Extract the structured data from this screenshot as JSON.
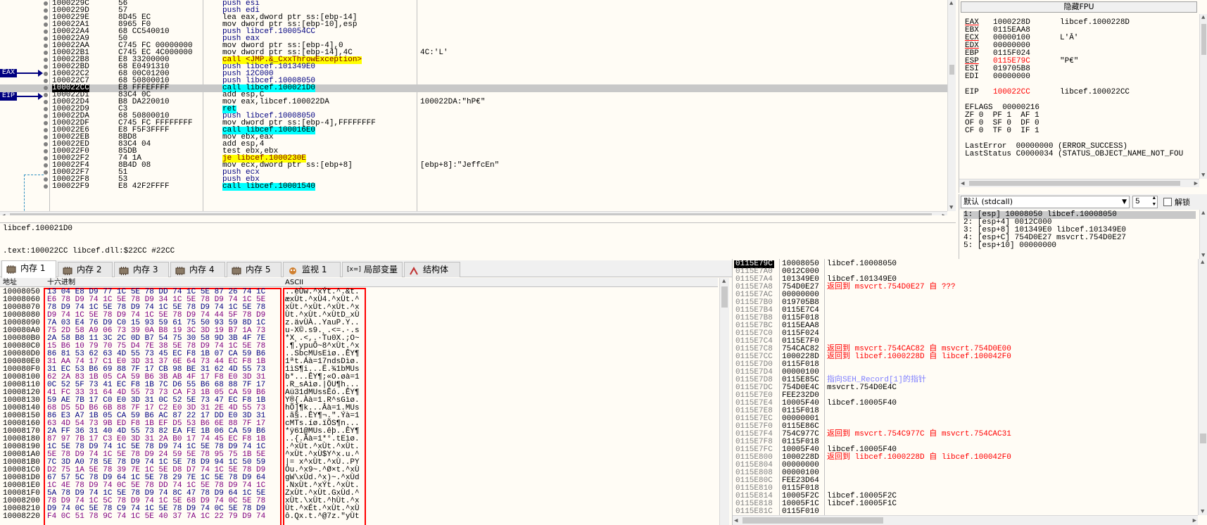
{
  "disasm": [
    {
      "addr": "1000229C",
      "bytes": "56",
      "ins": "push esi",
      "cmt": ""
    },
    {
      "addr": "1000229D",
      "bytes": "57",
      "ins": "push edi",
      "cmt": ""
    },
    {
      "addr": "1000229E",
      "bytes": "8D45 EC",
      "ins": "lea eax,dword ptr ss:[ebp-14]",
      "cmt": ""
    },
    {
      "addr": "100022A1",
      "bytes": "8965 F0",
      "ins": "mov dword ptr ss:[ebp-10],esp",
      "cmt": ""
    },
    {
      "addr": "100022A4",
      "bytes": "68 CC540010",
      "ins": "push libcef.100054CC",
      "cmt": ""
    },
    {
      "addr": "100022A9",
      "bytes": "50",
      "ins": "push eax",
      "cmt": ""
    },
    {
      "addr": "100022AA",
      "bytes": "C745 FC 00000000",
      "ins": "mov dword ptr ss:[ebp-4],0",
      "cmt": ""
    },
    {
      "addr": "100022B1",
      "bytes": "C745 EC 4C000000",
      "ins": "mov dword ptr ss:[ebp-14],4C",
      "cmt": "4C:'L'"
    },
    {
      "addr": "100022B8",
      "bytes": "E8 33200000",
      "ins": "call <JMP.&_CxxThrowException>",
      "cmt": ""
    },
    {
      "addr": "100022BD",
      "bytes": "68 E0491310",
      "ins": "push libcef.101349E0",
      "cmt": ""
    },
    {
      "addr": "100022C2",
      "bytes": "68 00C01200",
      "ins": "push 12C000",
      "cmt": ""
    },
    {
      "addr": "100022C7",
      "bytes": "68 50800010",
      "ins": "push libcef.10008050",
      "cmt": ""
    },
    {
      "addr": "100022CC",
      "bytes": "E8 FFFEFFFF",
      "ins": "call libcef.100021D0",
      "cmt": ""
    },
    {
      "addr": "100022D1",
      "bytes": "83C4 0C",
      "ins": "add esp,C",
      "cmt": ""
    },
    {
      "addr": "100022D4",
      "bytes": "B8 DA220010",
      "ins": "mov eax,libcef.100022DA",
      "cmt": "100022DA:\"hP€\""
    },
    {
      "addr": "100022D9",
      "bytes": "C3",
      "ins": "ret",
      "cmt": ""
    },
    {
      "addr": "100022DA",
      "bytes": "68 50800010",
      "ins": "push libcef.10008050",
      "cmt": ""
    },
    {
      "addr": "100022DF",
      "bytes": "C745 FC FFFFFFFF",
      "ins": "mov dword ptr ss:[ebp-4],FFFFFFFF",
      "cmt": ""
    },
    {
      "addr": "100022E6",
      "bytes": "E8 F5F3FFFF",
      "ins": "call libcef.100016E0",
      "cmt": ""
    },
    {
      "addr": "100022EB",
      "bytes": "8BD8",
      "ins": "mov ebx,eax",
      "cmt": ""
    },
    {
      "addr": "100022ED",
      "bytes": "83C4 04",
      "ins": "add esp,4",
      "cmt": ""
    },
    {
      "addr": "100022F0",
      "bytes": "85DB",
      "ins": "test ebx,ebx",
      "cmt": ""
    },
    {
      "addr": "100022F2",
      "bytes": "74 1A",
      "ins": "je libcef.1000230E",
      "cmt": ""
    },
    {
      "addr": "100022F4",
      "bytes": "8B4D 08",
      "ins": "mov ecx,dword ptr ss:[ebp+8]",
      "cmt": "[ebp+8]:\"JeffcEn\""
    },
    {
      "addr": "100022F7",
      "bytes": "51",
      "ins": "push ecx",
      "cmt": ""
    },
    {
      "addr": "100022F8",
      "bytes": "53",
      "ins": "push ebx",
      "cmt": ""
    },
    {
      "addr": "100022F9",
      "bytes": "E8 42F2FFFF",
      "ins": "call libcef.10001540",
      "cmt": ""
    }
  ],
  "disasm_tags": {
    "eax": "EAX",
    "eip": "EIP"
  },
  "info": {
    "line1": "libcef.100021D0",
    "line2": ".text:100022CC libcef.dll:$22CC #22CC"
  },
  "regs": {
    "fpu_button": "隐藏FPU",
    "rows": [
      {
        "n": "EAX",
        "v": "1000228D",
        "x": "libcef.1000228D"
      },
      {
        "n": "EBX",
        "v": "0115EAA8",
        "x": ""
      },
      {
        "n": "ECX",
        "v": "00000100",
        "x": "L'Ā'"
      },
      {
        "n": "EDX",
        "v": "00000000",
        "x": ""
      },
      {
        "n": "EBP",
        "v": "0115F024",
        "x": ""
      },
      {
        "n": "ESP",
        "v": "0115E79C",
        "x": "\"P€\""
      },
      {
        "n": "ESI",
        "v": "019705B8",
        "x": ""
      },
      {
        "n": "EDI",
        "v": "00000000",
        "x": ""
      },
      {
        "n": "",
        "v": "",
        "x": ""
      },
      {
        "n": "EIP",
        "v": "100022CC",
        "x": "libcef.100022CC"
      },
      {
        "n": "",
        "v": "",
        "x": ""
      },
      {
        "n": "EFLAGS",
        "v": "  00000216",
        "x": ""
      },
      {
        "n": "ZF 0  PF 1  AF 1",
        "v": "",
        "x": ""
      },
      {
        "n": "OF 0  SF 0  DF 0",
        "v": "",
        "x": ""
      },
      {
        "n": "CF 0  TF 0  IF 1",
        "v": "",
        "x": ""
      },
      {
        "n": "",
        "v": "",
        "x": ""
      },
      {
        "n": "LastError  00000000 (ERROR_SUCCESS)",
        "v": "",
        "x": ""
      },
      {
        "n": "LastStatus C0000034 (STATUS_OBJECT_NAME_NOT_FOU",
        "v": "",
        "x": ""
      }
    ]
  },
  "callconv": {
    "selected": "默认 (stdcall)",
    "count": "5",
    "unlock_label": "解锁"
  },
  "args": [
    "1: [esp] 10008050 libcef.10008050",
    "2: [esp+4] 0012C000",
    "3: [esp+8] 101349E0 libcef.101349E0",
    "4: [esp+C] 754D0E27 msvcrt.754D0E27",
    "5: [esp+10] 00000000"
  ],
  "tabs": [
    "内存 1",
    "内存 2",
    "内存 3",
    "内存 4",
    "内存 5",
    "监视 1",
    "局部变量",
    "结构体"
  ],
  "tab_icons": [
    "memory-icon",
    "memory-icon",
    "memory-icon",
    "memory-icon",
    "memory-icon",
    "watch-icon",
    "locals-icon",
    "struct-icon"
  ],
  "tab_local_prefix": "[x=]",
  "dump_headers": {
    "addr": "地址",
    "hex": "十六进制",
    "ascii": "ASCII"
  },
  "dump": [
    {
      "a": "10008050",
      "h": "13 04 E8 D9 77 1C 5E 78 DD 74 1C 5E 87 26 74 1C",
      "s": "..èÙw.^xÝt.^.&t."
    },
    {
      "a": "10008060",
      "h": "E6 78 D9 74 1C 5E 78 D9 34 1C 5E 78 D9 74 1C 5E",
      "s": "æxÙt.^xÙ4.^xÙt.^"
    },
    {
      "a": "10008070",
      "h": "78 D9 74 1C 5E 78 D9 74 1C 5E 78 D9 74 1C 5E 78",
      "s": "xÙt.^xÙt.^xÙt.^x"
    },
    {
      "a": "10008080",
      "h": "D9 74 1C 5E 78 D9 74 1C 5E 78 D9 74 44 5F 78 D9",
      "s": "Ùt.^xÙt.^xÙtD_xÙ"
    },
    {
      "a": "10008090",
      "h": "7A 03 E4 76 D9 C0 15 93 59 61 75 50 93 59 8D 1C",
      "s": "z.ävÙÀ..YauP.Y.."
    },
    {
      "a": "100080A0",
      "h": "75 2D 58 A9 06 73 39 0A B8 19 3C 3D 19 B7 1A 73",
      "s": "u-X©.s9.¸.<=.·.s"
    },
    {
      "a": "100080B0",
      "h": "2A 58 B8 11 3C 2C 0D B7 54 75 30 58 9D 3B 4F 7E",
      "s": "*X¸.<,.·Tu0X.;O~"
    },
    {
      "a": "100080C0",
      "h": "15 B6 10 79 70 75 D4 7E 38 5E 78 D9 74 1C 5E 78",
      "s": ".¶.ypuÔ~8^xÙt.^x"
    },
    {
      "a": "100080D0",
      "h": "86 81 53 62 63 4D 55 73 45 EC F8 1B 07 CA 59 B6",
      "s": "..SbcMUsEìø..ÊY¶"
    },
    {
      "a": "100080E0",
      "h": "31 AA 74 17 C1 E0 3D 31 37 6E 64 73 44 EC F8 1B",
      "s": "1ªt.Áà=17ndsDìø."
    },
    {
      "a": "100080F0",
      "h": "31 EC 53 B6 69 88 7F 17 CB 98 BE 31 62 4D 55 73",
      "s": "1ìS¶i...Ë.¾1bMUs"
    },
    {
      "a": "10008100",
      "h": "62 2A 83 1B 05 CA 59 B6 3B AB 4F 17 F8 E0 3D 31",
      "s": "b*...ÊY¶;«O.øà=1"
    },
    {
      "a": "10008110",
      "h": "0C 52 5F 73 41 EC F8 1B 7C D6 55 B6 68 88 7F 17",
      "s": ".R_sAìø.|ÖU¶h..."
    },
    {
      "a": "10008120",
      "h": "41 FC 33 31 64 4D 55 73 73 CA F3 1B 05 CA 59 B6",
      "s": "Aü31dMUssÊó..ÊY¶"
    },
    {
      "a": "10008130",
      "h": "59 AE 7B 17 C0 E0 3D 31 0C 52 5E 73 47 EC F8 1B",
      "s": "Y®{.Àà=1.R^sGìø."
    },
    {
      "a": "10008140",
      "h": "68 D5 5D B6 6B 88 7F 17 C2 E0 3D 31 2E 4D 55 73",
      "s": "hÕ]¶k...Âà=1.MUs"
    },
    {
      "a": "10008150",
      "h": "86 E3 A7 1B 05 CA 59 B6 AC 87 22 17 DD E0 3D 31",
      "s": ".ã§..ÊY¶¬.\".Ýà=1"
    },
    {
      "a": "10008160",
      "h": "63 4D 54 73 9B ED F8 1B EF D5 53 B6 6E 88 7F 17",
      "s": "cMTs.íø.ïÕS¶n..."
    },
    {
      "a": "10008170",
      "h": "2A FF 36 31 40 4D 55 73 82 EA FE 1B 06 CA 59 B6",
      "s": "*ÿ61@MUs.êþ..ÊY¶"
    },
    {
      "a": "10008180",
      "h": "87 97 7B 17 C3 E0 3D 31 2A B0 17 74 45 EC F8 1B",
      "s": "..{.Ãà=1*°.tEìø."
    },
    {
      "a": "10008190",
      "h": "1C 5E 78 D9 74 1C 5E 78 D9 74 1C 5E 78 D9 74 1C",
      "s": ".^xÙt.^xÙt.^xÙt."
    },
    {
      "a": "100081A0",
      "h": "5E 78 D9 74 1C 5E 78 D9 24 59 5E 78 95 75 1B 5E",
      "s": "^xÙt.^xÙ$Y^x.u.^"
    },
    {
      "a": "100081B0",
      "h": "7C 3D A0 78 5E 78 D9 74 1C 5E 78 D9 94 1C 50 59",
      "s": "|= x^xÙt.^xÙ..PY"
    },
    {
      "a": "100081C0",
      "h": "D2 75 1A 5E 78 39 7E 1C 5E D8 D7 74 1C 5E 78 D9",
      "s": "Òu.^x9~.^Ø×t.^xÙ"
    },
    {
      "a": "100081D0",
      "h": "67 57 5C 78 D9 64 1C 5E 78 29 7E 1C 5E 78 D9 64",
      "s": "gW\\xÙd.^x)~.^xÙd"
    },
    {
      "a": "100081E0",
      "h": "1C 4E 78 D9 74 0C 5E 78 DD 74 1C 5E 78 D9 74 1C",
      "s": ".NxÙt.^xÝt.^xÙt."
    },
    {
      "a": "100081F0",
      "h": "5A 78 D9 74 1C 5E 78 D9 74 8C 47 78 D9 64 1C 5E",
      "s": "ZxÙt.^xÙt.GxÙd.^"
    },
    {
      "a": "10008200",
      "h": "78 D9 74 1C 5C 78 D9 74 1C 5E 68 D9 74 0C 5E 78",
      "s": "xÙt.\\xÙt.^hÙt.^x"
    },
    {
      "a": "10008210",
      "h": "D9 74 0C 5E 78 C9 74 1C 5E 78 D9 74 0C 5E 78 D9",
      "s": "Ùt.^xÉt.^xÙt.^xÙ"
    },
    {
      "a": "10008220",
      "h": "F4 0C 51 78 9C 74 1C 5E 40 37 7A 1C 22 79 D9 74",
      "s": "ô.Qx.t.^@7z.\"yÙt"
    }
  ],
  "stack": [
    {
      "a": "0115E79C",
      "v": "10008050",
      "c": "libcef.10008050",
      "k": ""
    },
    {
      "a": "0115E7A0",
      "v": "0012C000",
      "c": "",
      "k": ""
    },
    {
      "a": "0115E7A4",
      "v": "101349E0",
      "c": "libcef.101349E0",
      "k": ""
    },
    {
      "a": "0115E7A8",
      "v": "754D0E27",
      "c": "返回到 msvcrt.754D0E27 自 ???",
      "k": "ret"
    },
    {
      "a": "0115E7AC",
      "v": "00000000",
      "c": "",
      "k": ""
    },
    {
      "a": "0115E7B0",
      "v": "019705B8",
      "c": "",
      "k": ""
    },
    {
      "a": "0115E7B4",
      "v": "0115E7C4",
      "c": "",
      "k": ""
    },
    {
      "a": "0115E7B8",
      "v": "0115F018",
      "c": "",
      "k": ""
    },
    {
      "a": "0115E7BC",
      "v": "0115EAA8",
      "c": "",
      "k": ""
    },
    {
      "a": "0115E7C0",
      "v": "0115F024",
      "c": "",
      "k": ""
    },
    {
      "a": "0115E7C4",
      "v": "0115E7F0",
      "c": "",
      "k": ""
    },
    {
      "a": "0115E7C8",
      "v": "754CAC82",
      "c": "返回到 msvcrt.754CAC82 自 msvcrt.754D0E00",
      "k": "ret"
    },
    {
      "a": "0115E7CC",
      "v": "1000228D",
      "c": "返回到 libcef.1000228D 自 libcef.100042F0",
      "k": "ret"
    },
    {
      "a": "0115E7D0",
      "v": "0115F018",
      "c": "",
      "k": ""
    },
    {
      "a": "0115E7D4",
      "v": "00000100",
      "c": "",
      "k": ""
    },
    {
      "a": "0115E7D8",
      "v": "0115E85C",
      "c": "指向SEH_Record[1]的指针",
      "k": "seh"
    },
    {
      "a": "0115E7DC",
      "v": "754D0E4C",
      "c": "msvcrt.754D0E4C",
      "k": ""
    },
    {
      "a": "0115E7E0",
      "v": "FEE232D0",
      "c": "",
      "k": ""
    },
    {
      "a": "0115E7E4",
      "v": "10005F40",
      "c": "libcef.10005F40",
      "k": ""
    },
    {
      "a": "0115E7E8",
      "v": "0115F018",
      "c": "",
      "k": ""
    },
    {
      "a": "0115E7EC",
      "v": "00000001",
      "c": "",
      "k": ""
    },
    {
      "a": "0115E7F0",
      "v": "0115E86C",
      "c": "",
      "k": ""
    },
    {
      "a": "0115E7F4",
      "v": "754C977C",
      "c": "返回到 msvcrt.754C977C 自 msvcrt.754CAC31",
      "k": "ret"
    },
    {
      "a": "0115E7F8",
      "v": "0115F018",
      "c": "",
      "k": ""
    },
    {
      "a": "0115E7FC",
      "v": "10005F40",
      "c": "libcef.10005F40",
      "k": ""
    },
    {
      "a": "0115E800",
      "v": "1000228D",
      "c": "返回到 libcef.1000228D 自 libcef.100042F0",
      "k": "ret"
    },
    {
      "a": "0115E804",
      "v": "00000000",
      "c": "",
      "k": ""
    },
    {
      "a": "0115E808",
      "v": "00000100",
      "c": "",
      "k": ""
    },
    {
      "a": "0115E80C",
      "v": "FEE23D64",
      "c": "",
      "k": ""
    },
    {
      "a": "0115E810",
      "v": "0115F018",
      "c": "",
      "k": ""
    },
    {
      "a": "0115E814",
      "v": "10005F2C",
      "c": "libcef.10005F2C",
      "k": ""
    },
    {
      "a": "0115E818",
      "v": "10005F1C",
      "c": "libcef.10005F1C",
      "k": ""
    },
    {
      "a": "0115E81C",
      "v": "0115F010",
      "c": "",
      "k": ""
    }
  ],
  "colors": {
    "background": "#fffcf5",
    "selection": "#c8c8c8",
    "call_highlight": "#00ffff",
    "jump_highlight": "#ffff00",
    "return_text": "#ff0000",
    "tag": "#000080",
    "dump_box": "#ff0000"
  }
}
